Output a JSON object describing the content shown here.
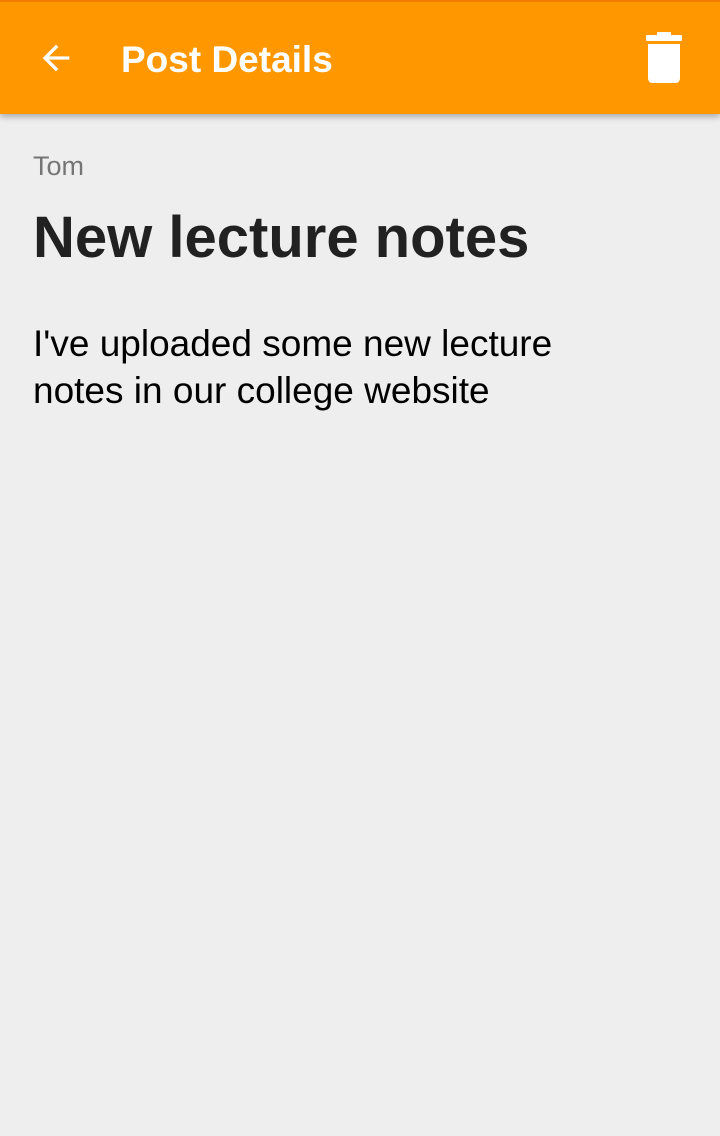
{
  "app_bar": {
    "title": "Post Details",
    "back_icon": "arrow-left-icon",
    "delete_icon": "trash-icon",
    "background_color": "#ff9800"
  },
  "post": {
    "author": "Tom",
    "title": "New lecture notes",
    "body": "I've uploaded some new lecture notes in our college website"
  },
  "colors": {
    "screen_background": "#eeeeee",
    "author_text": "#757575",
    "title_text": "#212121"
  }
}
